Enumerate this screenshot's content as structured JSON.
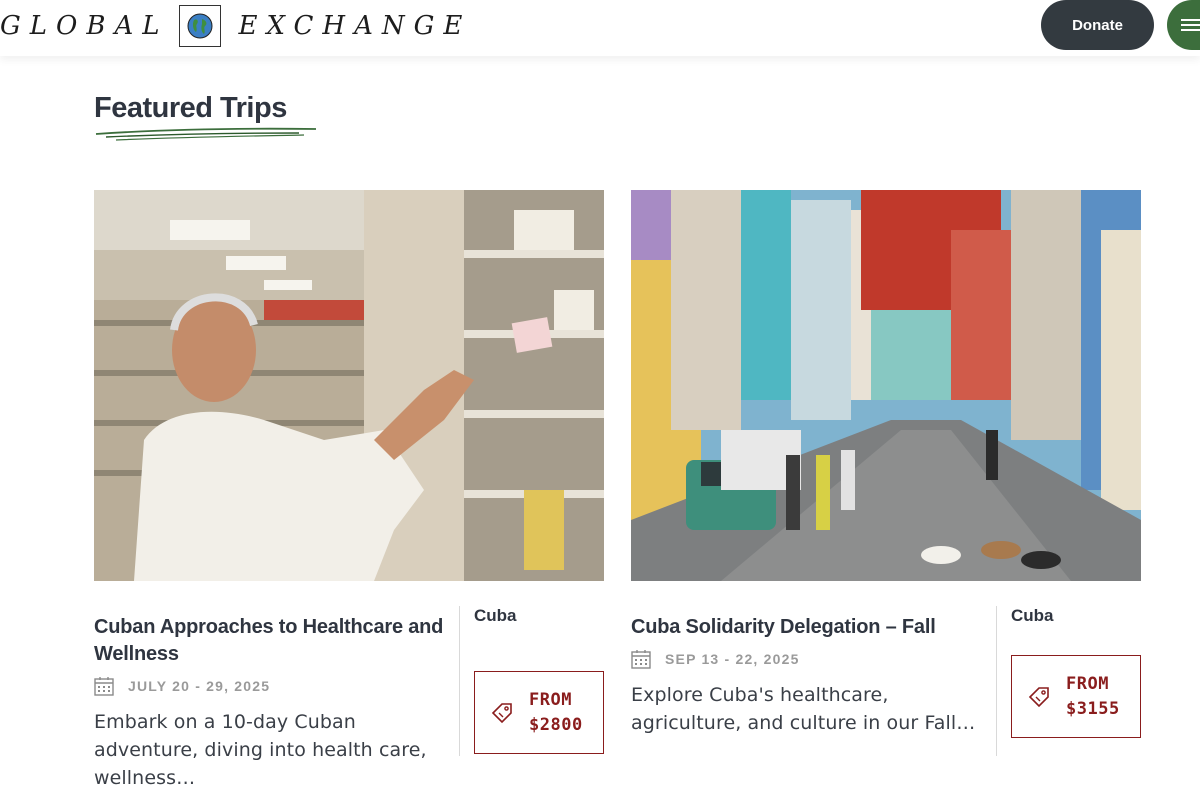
{
  "header": {
    "logo_left": "GLOBAL",
    "logo_right": "EXCHANGE",
    "logo_icon": "globe-icon",
    "donate_label": "Donate",
    "menu_icon": "hamburger-icon"
  },
  "section": {
    "title": "Featured Trips"
  },
  "trips": [
    {
      "title": "Cuban Approaches to Healthcare and Wellness",
      "date": "JULY 20 - 29, 2025",
      "description": "Embark on a 10-day Cuban adventure, diving into health care, wellness…",
      "location": "Cuba",
      "price_prefix": "FROM",
      "price": "$2800",
      "image_icon": "pharmacist-photo"
    },
    {
      "title": "Cuba Solidarity Delegation – Fall",
      "date": "SEP 13 - 22, 2025",
      "description": "Explore Cuba's healthcare, agriculture, and culture in our Fall…",
      "location": "Cuba",
      "price_prefix": "FROM",
      "price": "$3155",
      "image_icon": "havana-street-photo"
    }
  ],
  "colors": {
    "donate_bg": "#333a40",
    "menu_bg": "#3c6e3c",
    "price_accent": "#8a1d1d",
    "heading": "#2f3540",
    "date_gray": "#9a9a9a"
  }
}
